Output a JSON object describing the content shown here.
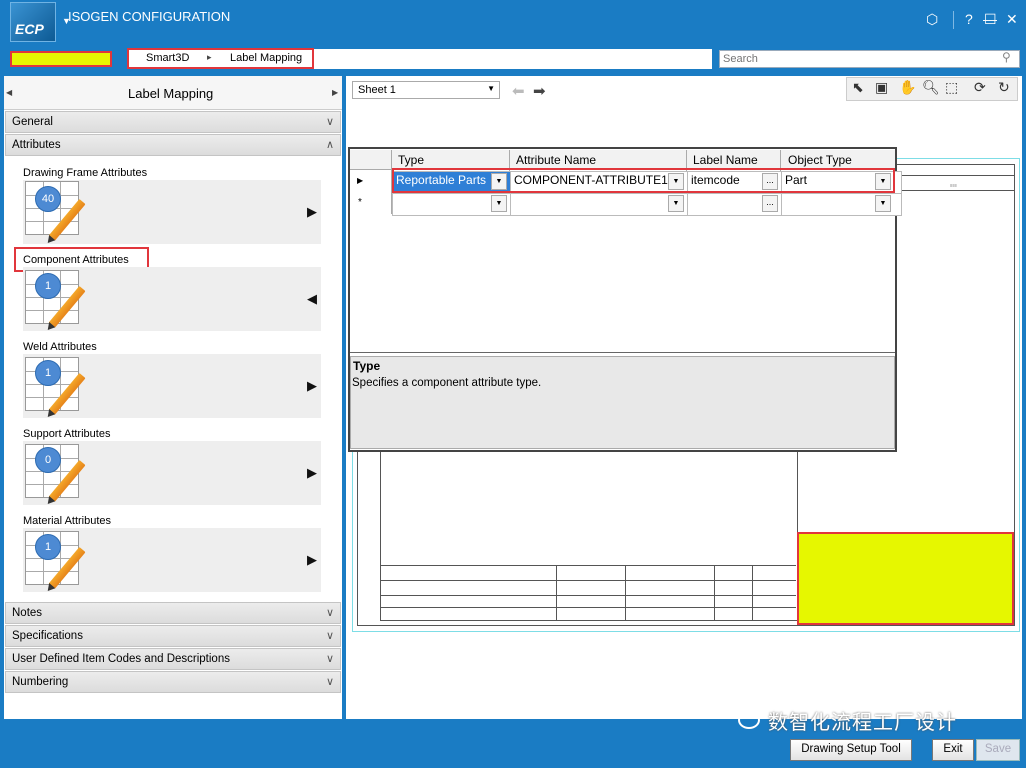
{
  "app": {
    "logo_text": "ECP",
    "title": "ISOGEN CONFIGURATION",
    "help": "?",
    "minimize": "—",
    "maximize": "☐",
    "close": "✕"
  },
  "breadcrumb": {
    "items": [
      "Smart3D",
      "Label Mapping"
    ],
    "separator": "▸"
  },
  "search": {
    "placeholder": "Search"
  },
  "left_panel": {
    "title": "Label Mapping",
    "sections": [
      {
        "label": "General",
        "expanded": false
      },
      {
        "label": "Attributes",
        "expanded": true
      }
    ],
    "attribute_tiles": [
      {
        "label": "Drawing Frame Attributes",
        "count": "40"
      },
      {
        "label": "Component Attributes",
        "count": "1"
      },
      {
        "label": "Weld Attributes",
        "count": "1"
      },
      {
        "label": "Support Attributes",
        "count": "0"
      },
      {
        "label": "Material Attributes",
        "count": "1"
      }
    ],
    "lower_sections": [
      "Notes",
      "Specifications",
      "User Defined Item Codes and Descriptions",
      "Numbering"
    ]
  },
  "viewer": {
    "sheet": "Sheet 1"
  },
  "grid": {
    "columns": [
      "Type",
      "Attribute Name",
      "Label Name",
      "Object Type"
    ],
    "rows": [
      {
        "type": "Reportable Parts",
        "attribute_name": "COMPONENT-ATTRIBUTE1",
        "label_name": "itemcode",
        "object_type": "Part"
      }
    ],
    "new_row_marker": "*",
    "ellipsis": "..."
  },
  "description": {
    "title": "Type",
    "text": "Specifies a component attribute type."
  },
  "footer": {
    "drawing_setup": "Drawing Setup Tool",
    "exit": "Exit",
    "save": "Save",
    "watermark": "数智化流程工厂设计"
  },
  "colors": {
    "brand": "#1a7cc4",
    "highlight": "#e1363c",
    "redaction": "#e6f700",
    "selection": "#2f7fd6"
  }
}
